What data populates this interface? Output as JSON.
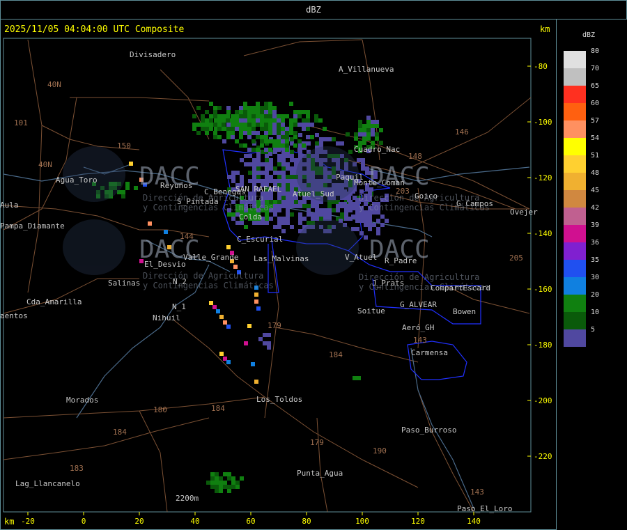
{
  "window": {
    "title": "dBZ"
  },
  "header": {
    "timestamp": "2025/11/05 04:04:00 UTC Composite",
    "unit_top": "km",
    "unit_bottom": "km"
  },
  "axes": {
    "x_ticks": [
      "-20",
      "0",
      "20",
      "40",
      "60",
      "80",
      "100",
      "120",
      "140"
    ],
    "y_ticks": [
      "-80",
      "-100",
      "-120",
      "-140",
      "-160",
      "-180",
      "-200",
      "-220"
    ]
  },
  "places": [
    "Divisadero",
    "A_Villanueva",
    "Agua_Toro",
    "Reyunos",
    "S_Pintada",
    "C_Benegas",
    "SAN RAFAEL",
    "Atuel_Sud",
    "Monte_Coman",
    "Goico",
    "G_Campos",
    "Pampa_Diamante",
    "Colda",
    "C_Escurial",
    "Valle_Grande",
    "El_Desvio",
    "Salinas",
    "Las_Malvinas",
    "V_Atuel",
    "R_Padre",
    "Soitue",
    "G_ALVEAR",
    "Bowen",
    "Aeró_GH",
    "Carmensa",
    "Cda_Amarilla",
    "Nihuil",
    "N_1",
    "N_2",
    "Los_Toldos",
    "Morados",
    "Paso_Burroso",
    "Punta_Agua",
    "Lag_Llancanelo",
    "Paso_El_Loro",
    "CompartEscard",
    "Ovejer",
    "J_Prats",
    "Paquil",
    "Cuadro_Nac",
    "Aula",
    "DACC",
    "Dirección de Agricultura",
    "y Contingencias Climáticas",
    "aentos",
    "2200m"
  ],
  "road_numbers": [
    "40N",
    "40N",
    "101",
    "150",
    "144",
    "146",
    "148",
    "203",
    "205",
    "179",
    "184",
    "180",
    "184",
    "184",
    "183",
    "179",
    "190",
    "143",
    "143"
  ],
  "legend": {
    "title": "dBZ",
    "levels": [
      {
        "label": "80",
        "color": "#e0e0e0"
      },
      {
        "label": "70",
        "color": "#c0c0c0"
      },
      {
        "label": "65",
        "color": "#ff3020"
      },
      {
        "label": "60",
        "color": "#ff6010"
      },
      {
        "label": "57",
        "color": "#ff9060"
      },
      {
        "label": "54",
        "color": "#ffff00"
      },
      {
        "label": "51",
        "color": "#ffd030"
      },
      {
        "label": "48",
        "color": "#f0b030"
      },
      {
        "label": "45",
        "color": "#d08840"
      },
      {
        "label": "42",
        "color": "#c06090"
      },
      {
        "label": "39",
        "color": "#d01090"
      },
      {
        "label": "36",
        "color": "#8020d0"
      },
      {
        "label": "35",
        "color": "#2050f0"
      },
      {
        "label": "30",
        "color": "#1080e0"
      },
      {
        "label": "20",
        "color": "#108010"
      },
      {
        "label": "10",
        "color": "#0a5a0a"
      },
      {
        "label": "5",
        "color": "#5048a0"
      }
    ]
  },
  "colors": {
    "frame": "#5f8f9a",
    "tick_label": "#ffff00",
    "border_blue": "#2030ff",
    "road": "#b07850",
    "river": "#5a7a9a"
  }
}
